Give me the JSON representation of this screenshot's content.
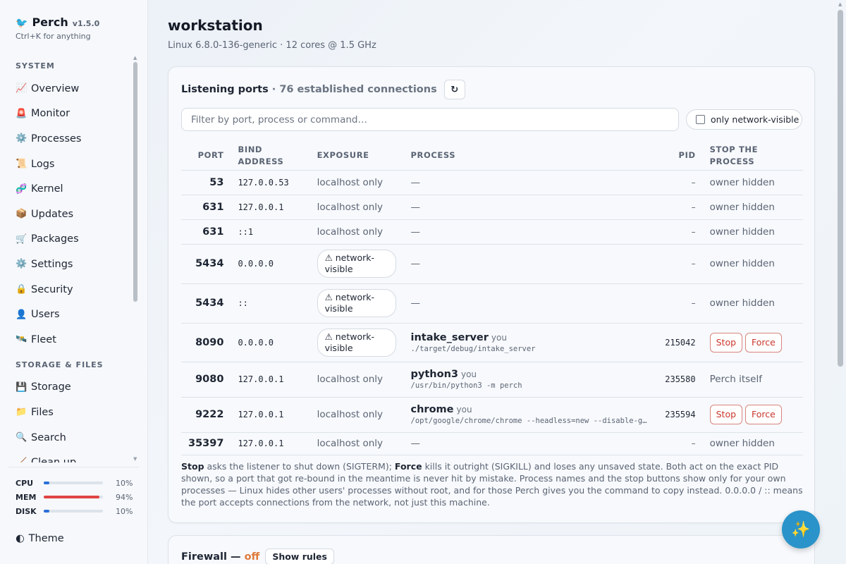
{
  "app": {
    "name": "Perch",
    "version": "v1.5.0",
    "tagline": "Ctrl+K for anything"
  },
  "sidebar": {
    "sections": [
      {
        "title": "SYSTEM",
        "items": [
          {
            "icon": "📈",
            "label": "Overview"
          },
          {
            "icon": "🚨",
            "label": "Monitor"
          },
          {
            "icon": "⚙️",
            "label": "Processes"
          },
          {
            "icon": "📜",
            "label": "Logs"
          },
          {
            "icon": "🧬",
            "label": "Kernel"
          },
          {
            "icon": "📦",
            "label": "Updates"
          },
          {
            "icon": "🛒",
            "label": "Packages"
          },
          {
            "icon": "⚙️",
            "label": "Settings"
          },
          {
            "icon": "🔒",
            "label": "Security"
          },
          {
            "icon": "👤",
            "label": "Users"
          },
          {
            "icon": "🛰️",
            "label": "Fleet"
          }
        ]
      },
      {
        "title": "STORAGE & FILES",
        "items": [
          {
            "icon": "💾",
            "label": "Storage"
          },
          {
            "icon": "📁",
            "label": "Files"
          },
          {
            "icon": "🔍",
            "label": "Search"
          },
          {
            "icon": "🧹",
            "label": "Clean up"
          }
        ]
      }
    ],
    "stats": [
      {
        "label": "CPU",
        "value": "10%",
        "fraction": 0.1,
        "color": "#2b6fd6"
      },
      {
        "label": "MEM",
        "value": "94%",
        "fraction": 0.94,
        "color": "#e04444"
      },
      {
        "label": "DISK",
        "value": "10%",
        "fraction": 0.1,
        "color": "#2b6fd6"
      }
    ],
    "theme_icon": "◐",
    "theme_label": "Theme"
  },
  "header": {
    "title": "workstation",
    "subtitle": "Linux 6.8.0-136-generic · 12 cores @ 1.5 GHz"
  },
  "ports": {
    "title": "Listening ports",
    "connections": "· 76 established connections",
    "refresh_icon": "↻",
    "filter_placeholder": "Filter by port, process or command…",
    "toggle_label": "only network-visible",
    "columns": [
      "PORT",
      "BIND ADDRESS",
      "EXPOSURE",
      "PROCESS",
      "PID",
      "STOP THE PROCESS"
    ],
    "rows": [
      {
        "port": "53",
        "bind": "127.0.0.53",
        "exposure": "localhost only",
        "net": false,
        "proc": null,
        "pid": "–",
        "action": "owner hidden"
      },
      {
        "port": "631",
        "bind": "127.0.0.1",
        "exposure": "localhost only",
        "net": false,
        "proc": null,
        "pid": "–",
        "action": "owner hidden"
      },
      {
        "port": "631",
        "bind": "::1",
        "exposure": "localhost only",
        "net": false,
        "proc": null,
        "pid": "–",
        "action": "owner hidden"
      },
      {
        "port": "5434",
        "bind": "0.0.0.0",
        "exposure": "⚠ network-visible",
        "net": true,
        "proc": null,
        "pid": "–",
        "action": "owner hidden"
      },
      {
        "port": "5434",
        "bind": "::",
        "exposure": "⚠ network-visible",
        "net": true,
        "proc": null,
        "pid": "–",
        "action": "owner hidden"
      },
      {
        "port": "8090",
        "bind": "0.0.0.0",
        "exposure": "⚠ network-visible",
        "net": true,
        "proc": {
          "name": "intake_server",
          "owner": "you",
          "cmd": "./target/debug/intake_server"
        },
        "pid": "215042",
        "action": "buttons"
      },
      {
        "port": "9080",
        "bind": "127.0.0.1",
        "exposure": "localhost only",
        "net": false,
        "proc": {
          "name": "python3",
          "owner": "you",
          "cmd": "/usr/bin/python3 -m perch"
        },
        "pid": "235580",
        "action": "Perch itself"
      },
      {
        "port": "9222",
        "bind": "127.0.0.1",
        "exposure": "localhost only",
        "net": false,
        "proc": {
          "name": "chrome",
          "owner": "you",
          "cmd": "/opt/google/chrome/chrome --headless=new --disable-g…"
        },
        "pid": "235594",
        "action": "buttons"
      },
      {
        "port": "35397",
        "bind": "127.0.0.1",
        "exposure": "localhost only",
        "net": false,
        "proc": null,
        "pid": "–",
        "action": "owner hidden"
      }
    ],
    "no_process": "—",
    "stop_label": "Stop",
    "force_label": "Force",
    "footnote": {
      "stop_word": "Stop",
      "part1": " asks the listener to shut down (SIGTERM); ",
      "force_word": "Force",
      "part2": " kills it outright (SIGKILL) and loses any unsaved state. Both act on the exact PID shown, so a port that got re-bound in the meantime is never hit by mistake. Process names and the stop buttons show only for your own processes — Linux hides other users' processes without root, and for those Perch gives you the command to copy instead. 0.0.0.0 / :: means the port accepts connections from the network, not just this machine."
    }
  },
  "firewall": {
    "title": "Firewall —",
    "status": "off",
    "button": "Show rules"
  },
  "fab_icon": "✨"
}
